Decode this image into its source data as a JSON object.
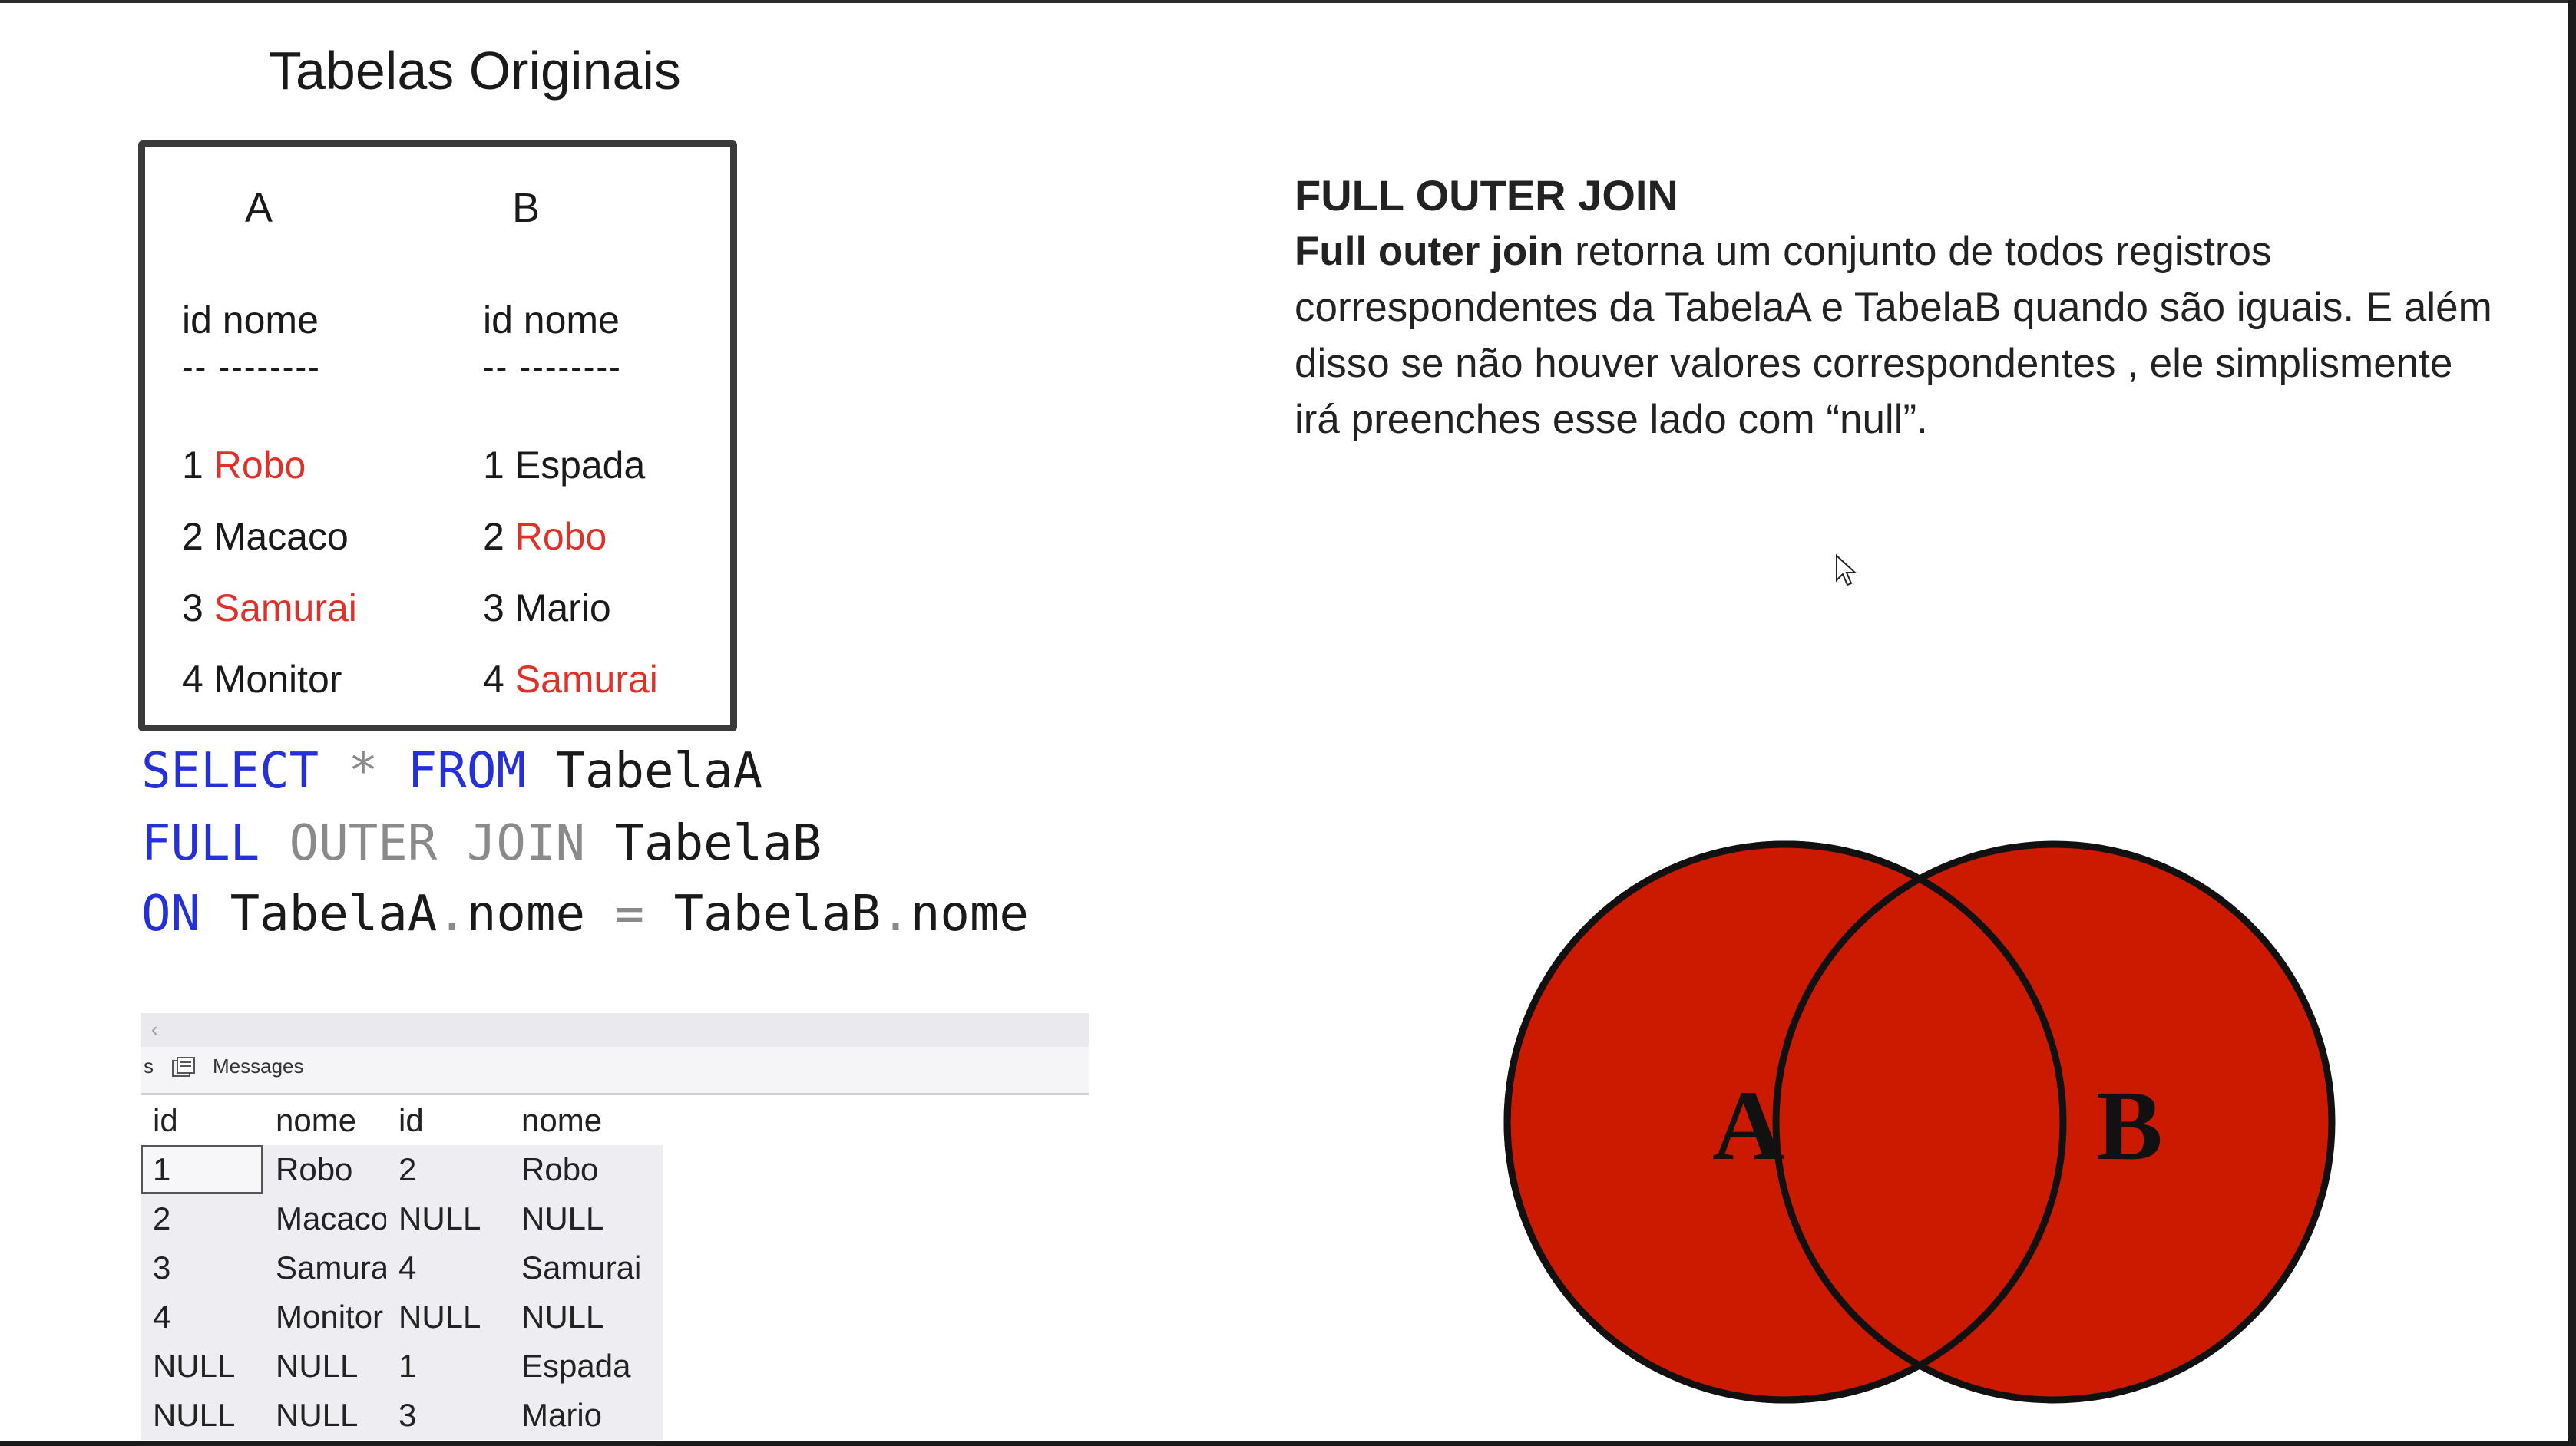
{
  "slide": {
    "title": "Tabelas Originais"
  },
  "tables": {
    "a": {
      "label": "A",
      "header": "id nome",
      "dash": "-- --------",
      "rows": [
        {
          "id": "1",
          "nome": "Robo"
        },
        {
          "id": "2",
          "nome": "Macaco"
        },
        {
          "id": "3",
          "nome": "Samurai"
        },
        {
          "id": "4",
          "nome": "Monitor"
        }
      ]
    },
    "b": {
      "label": "B",
      "header": "id nome",
      "dash": "-- --------",
      "rows": [
        {
          "id": "1",
          "nome": "Espada"
        },
        {
          "id": "2",
          "nome": "Robo"
        },
        {
          "id": "3",
          "nome": "Mario"
        },
        {
          "id": "4",
          "nome": "Samurai"
        }
      ]
    }
  },
  "sql": {
    "select": "SELECT",
    "star": "*",
    "from": "FROM",
    "table_a": "TabelaA",
    "full": "FULL",
    "outer": "OUTER",
    "join": "JOIN",
    "table_b": "TabelaB",
    "on": "ON",
    "a_ref": "TabelaA",
    "dot": ".",
    "col": "nome",
    "eq": "=",
    "b_ref": "TabelaB"
  },
  "description": {
    "heading": "FULL OUTER JOIN",
    "lead": "Full outer join",
    "body": " retorna um conjunto de todos registros correspondentes da TabelaA e TabelaB quando são iguais. E além disso se não houver valores correspondentes , ele simplismente irá preenches esse lado com “null”."
  },
  "results": {
    "tab_results_fragment": "s",
    "tab_messages": "Messages",
    "columns": [
      "id",
      "nome",
      "id",
      "nome"
    ],
    "rows": [
      [
        "1",
        "Robo",
        "2",
        "Robo"
      ],
      [
        "2",
        "Macaco",
        "NULL",
        "NULL"
      ],
      [
        "3",
        "Samurai",
        "4",
        "Samurai"
      ],
      [
        "4",
        "Monitor",
        "NULL",
        "NULL"
      ],
      [
        "NULL",
        "NULL",
        "1",
        "Espada"
      ],
      [
        "NULL",
        "NULL",
        "3",
        "Mario"
      ]
    ]
  },
  "venn": {
    "left_label": "A",
    "right_label": "B",
    "fill_color": "#cc1a00",
    "stroke_color": "#111111"
  },
  "colors": {
    "match_highlight": "#e0302a",
    "sql_keyword": "#2630d8",
    "sql_muted": "#8a8a8a"
  }
}
